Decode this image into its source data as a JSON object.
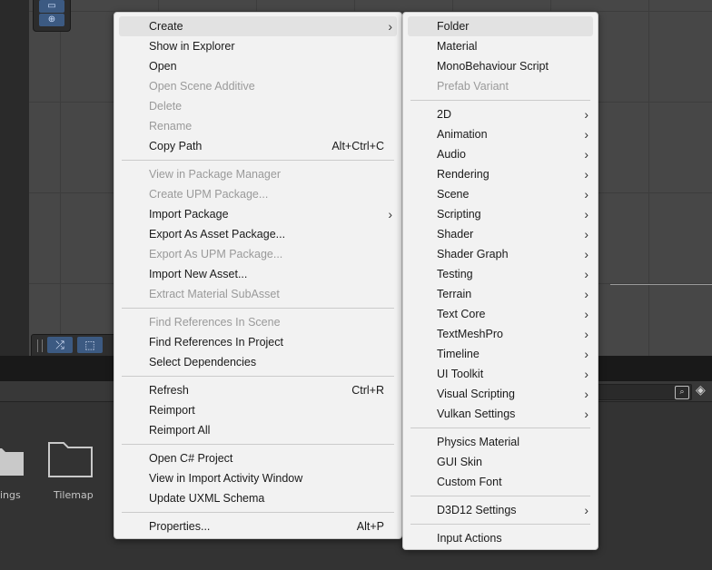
{
  "assets": [
    {
      "label": "ings"
    },
    {
      "label": "Tilemap"
    }
  ],
  "context_menu": {
    "groups": [
      [
        {
          "label": "Create",
          "submenu": true,
          "highlighted": true
        },
        {
          "label": "Show in Explorer"
        },
        {
          "label": "Open"
        },
        {
          "label": "Open Scene Additive",
          "disabled": true
        },
        {
          "label": "Delete",
          "disabled": true
        },
        {
          "label": "Rename",
          "disabled": true
        },
        {
          "label": "Copy Path",
          "shortcut": "Alt+Ctrl+C"
        }
      ],
      [
        {
          "label": "View in Package Manager",
          "disabled": true
        },
        {
          "label": "Create UPM Package...",
          "disabled": true
        },
        {
          "label": "Import Package",
          "submenu": true
        },
        {
          "label": "Export As Asset Package..."
        },
        {
          "label": "Export As UPM Package...",
          "disabled": true
        },
        {
          "label": "Import New Asset..."
        },
        {
          "label": "Extract Material SubAsset",
          "disabled": true
        }
      ],
      [
        {
          "label": "Find References In Scene",
          "disabled": true
        },
        {
          "label": "Find References In Project"
        },
        {
          "label": "Select Dependencies"
        }
      ],
      [
        {
          "label": "Refresh",
          "shortcut": "Ctrl+R"
        },
        {
          "label": "Reimport"
        },
        {
          "label": "Reimport All"
        }
      ],
      [
        {
          "label": "Open C# Project"
        },
        {
          "label": "View in Import Activity Window"
        },
        {
          "label": "Update UXML Schema"
        }
      ],
      [
        {
          "label": "Properties...",
          "shortcut": "Alt+P"
        }
      ]
    ]
  },
  "create_submenu": {
    "groups": [
      [
        {
          "label": "Folder",
          "highlighted": true
        },
        {
          "label": "Material"
        },
        {
          "label": "MonoBehaviour Script"
        },
        {
          "label": "Prefab Variant",
          "disabled": true
        }
      ],
      [
        {
          "label": "2D",
          "submenu": true
        },
        {
          "label": "Animation",
          "submenu": true
        },
        {
          "label": "Audio",
          "submenu": true
        },
        {
          "label": "Rendering",
          "submenu": true
        },
        {
          "label": "Scene",
          "submenu": true
        },
        {
          "label": "Scripting",
          "submenu": true
        },
        {
          "label": "Shader",
          "submenu": true
        },
        {
          "label": "Shader Graph",
          "submenu": true
        },
        {
          "label": "Testing",
          "submenu": true
        },
        {
          "label": "Terrain",
          "submenu": true
        },
        {
          "label": "Text Core",
          "submenu": true
        },
        {
          "label": "TextMeshPro",
          "submenu": true
        },
        {
          "label": "Timeline",
          "submenu": true
        },
        {
          "label": "UI Toolkit",
          "submenu": true
        },
        {
          "label": "Visual Scripting",
          "submenu": true
        },
        {
          "label": "Vulkan Settings",
          "submenu": true
        }
      ],
      [
        {
          "label": "Physics Material"
        },
        {
          "label": "GUI Skin"
        },
        {
          "label": "Custom Font"
        }
      ],
      [
        {
          "label": "D3D12 Settings",
          "submenu": true
        }
      ],
      [
        {
          "label": "Input Actions"
        }
      ]
    ]
  },
  "icons": {
    "submenu_arrow": "chevron-right-icon",
    "search_type": "search-type-icon",
    "folder": "folder-icon"
  }
}
